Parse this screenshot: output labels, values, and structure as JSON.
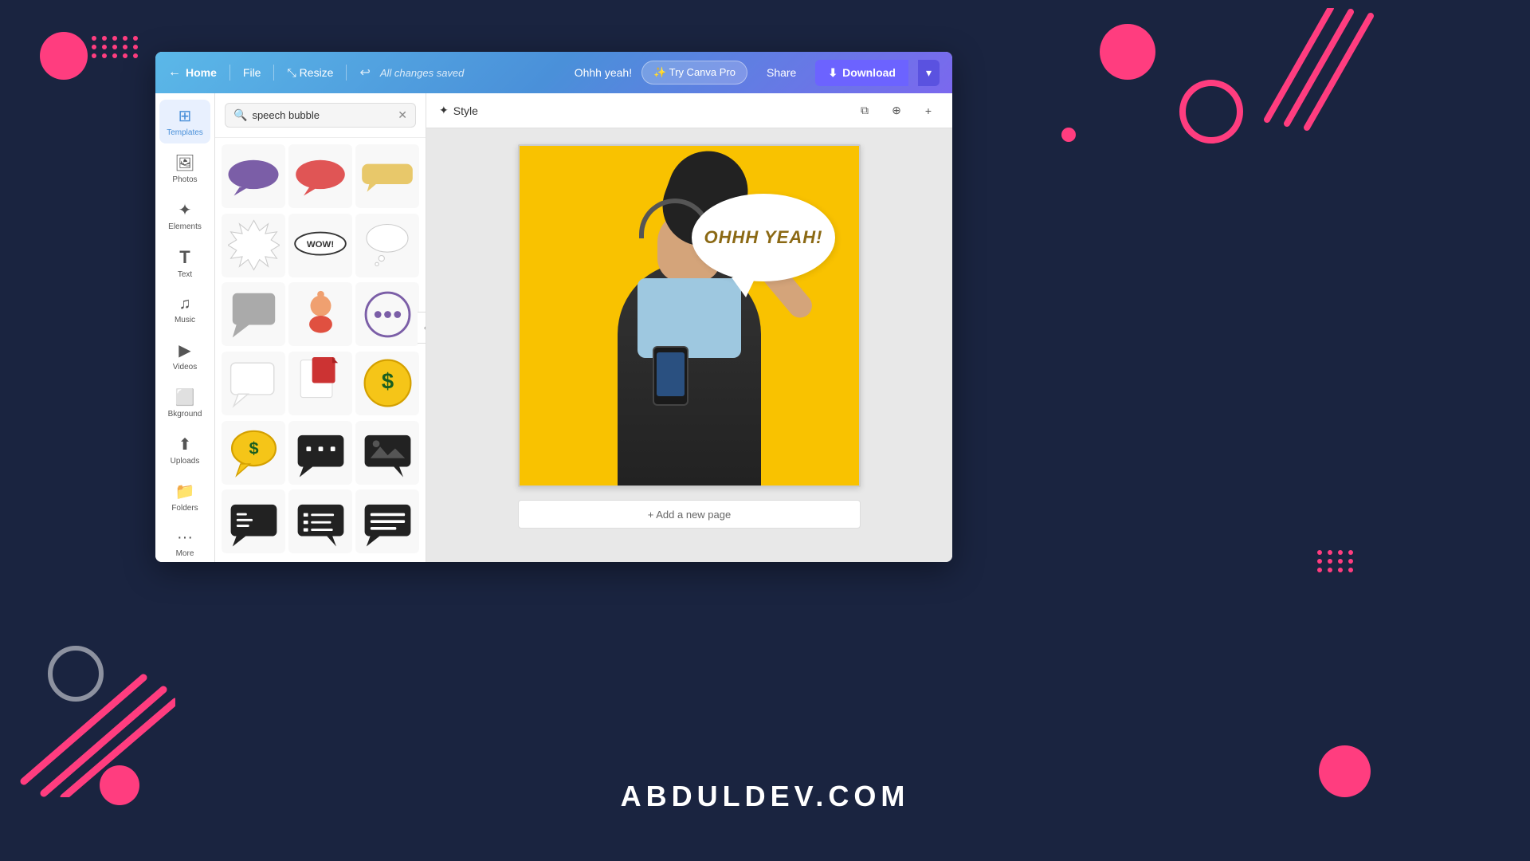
{
  "background": {
    "color": "#1a2440"
  },
  "navbar": {
    "home_label": "Home",
    "file_label": "File",
    "resize_label": "Resize",
    "saved_label": "All changes saved",
    "project_name": "Ohhh yeah!",
    "try_pro_label": "✨ Try Canva Pro",
    "share_label": "Share",
    "download_label": "Download"
  },
  "sidebar": {
    "items": [
      {
        "id": "templates",
        "label": "Templates",
        "icon": "⊞"
      },
      {
        "id": "photos",
        "label": "Photos",
        "icon": "🖼"
      },
      {
        "id": "elements",
        "label": "Elements",
        "icon": "✦"
      },
      {
        "id": "text",
        "label": "Text",
        "icon": "T"
      },
      {
        "id": "music",
        "label": "Music",
        "icon": "♪"
      },
      {
        "id": "videos",
        "label": "Videos",
        "icon": "▶"
      },
      {
        "id": "background",
        "label": "Bkground",
        "icon": "⬜"
      },
      {
        "id": "uploads",
        "label": "Uploads",
        "icon": "↑"
      },
      {
        "id": "folders",
        "label": "Folders",
        "icon": "📁"
      },
      {
        "id": "more",
        "label": "More",
        "icon": "···"
      }
    ]
  },
  "panel": {
    "search_placeholder": "speech bubble",
    "search_value": "speech bubble"
  },
  "canvas": {
    "style_label": "Style",
    "bubble_text": "OHHH YEAH!",
    "add_page_label": "+ Add a new page"
  },
  "watermark": {
    "text": "ABDULDEV.COM"
  }
}
